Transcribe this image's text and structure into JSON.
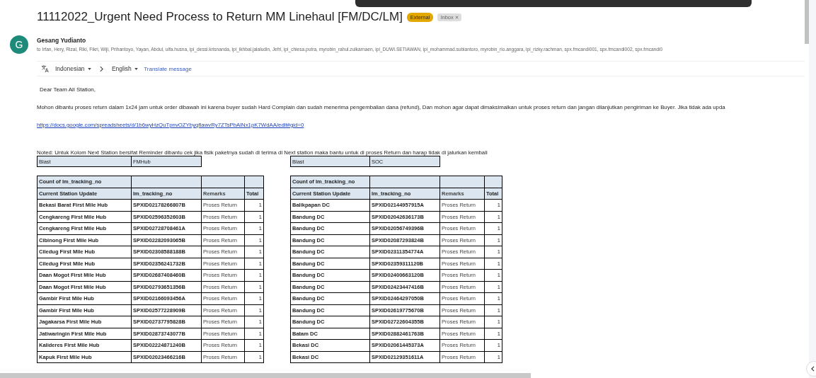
{
  "subject": "11112022_Urgent Need Process to Return MM Linehaul [FM/DC/LM]",
  "labels": [
    {
      "text": "External",
      "kind": "external"
    },
    {
      "text": "Inbox",
      "kind": "inbox"
    }
  ],
  "sender": {
    "initial": "G",
    "name": "Gesang Yudianto",
    "recipients": "to Irfan, Hery, Rizal, Riki, Fikri, Wiji, Prihantoyo, Yayan, Abdul, ulfa.husna, ipi_dessi.krisnanda, ipi_ikhbal.jalaludin, Jefri, ipi_chiesa.putra, myrobin_rahul.zulkarnaen, ipi_DUWI.SETIAWAN, ipi_mohammad.subiantoro, myrobin_rio.anggara, ipi_rizky.rachman, spx.fmcandi001, spx.fmcandi002, spx.fmcandi0"
  },
  "translate": {
    "from": "Indonesian",
    "to": "English",
    "action": "Translate message"
  },
  "body": {
    "greeting": "Dear Team All Station,",
    "paragraph": "Mohon dibantu proses return dalam 1x24 jam untuk order dibawah ini karena buyer sudah Hard Complain dan sudah menerima pengembalian dana (refund), Dan mohon agar dapat dimaksimalkan untuk proses return dan jangan dilanjutkan pengiriman ke Buyer. Jika tidak ada upda",
    "link": "https://docs.google.com/spreadsheets/d/1b6wyHzQuTpnvOZYbyqflawvRy7ZTsPbAlNx1pK7WdAA/edit#gid=0",
    "note": "Noted: Untuk Kolom Next Station bersifat Reminder dibantu cek jika fisik paketnya sudah di terima di Next station maka bantu untuk di proses Return dan harap tidak di jalurkan kembali"
  },
  "tables": [
    {
      "blast": [
        "Blast",
        "FMHub"
      ],
      "pivot_title": "Count of lm_tracking_no",
      "columns": [
        "Current Station Update",
        "lm_tracking_no",
        "Remarks",
        "Total"
      ],
      "rows": [
        [
          "Bekasi Barat First Mile Hub",
          "SPXID02178266807B",
          "Proses Return",
          "1"
        ],
        [
          "Cengkareng First Mile Hub",
          "SPXID02596352603B",
          "Proses Return",
          "1"
        ],
        [
          "Cengkareng First Mile Hub",
          "SPXID02728708461A",
          "Proses Return",
          "1"
        ],
        [
          "Cibinong First Mile Hub",
          "SPXID02282093065B",
          "Proses Return",
          "1"
        ],
        [
          "Ciledug First Mile Hub",
          "SPXID02308588188B",
          "Proses Return",
          "1"
        ],
        [
          "Ciledug First Mile Hub",
          "SPXID02356241732B",
          "Proses Return",
          "1"
        ],
        [
          "Daan Mogot First Mile Hub",
          "SPXID02687408460B",
          "Proses Return",
          "1"
        ],
        [
          "Daan Mogot First Mile Hub",
          "SPXID02793651356B",
          "Proses Return",
          "1"
        ],
        [
          "Gambir First Mile Hub",
          "SPXID02166093456A",
          "Proses Return",
          "1"
        ],
        [
          "Gambir First Mile Hub",
          "SPXID02577228909B",
          "Proses Return",
          "1"
        ],
        [
          "Jagakarsa First Mile Hub",
          "SPXID02737795828B",
          "Proses Return",
          "1"
        ],
        [
          "Jatiwaringin First Mile Hub",
          "SPXID02873743077B",
          "Proses Return",
          "1"
        ],
        [
          "Kalideres First Mile Hub",
          "SPXID02224871240B",
          "Proses Return",
          "1"
        ],
        [
          "Kapuk First Mile Hub",
          "SPXID02023466216B",
          "Proses Return",
          "1"
        ]
      ]
    },
    {
      "blast": [
        "Blast",
        "SOC"
      ],
      "pivot_title": "Count of lm_tracking_no",
      "columns": [
        "Current Station Update",
        "lm_tracking_no",
        "Remarks",
        "Total"
      ],
      "rows": [
        [
          "Balikpapan DC",
          "SPXID02144957915A",
          "Proses Return",
          "1"
        ],
        [
          "Bandung DC",
          "SPXID02042636173B",
          "Proses Return",
          "1"
        ],
        [
          "Bandung DC",
          "SPXID02056749396B",
          "Proses Return",
          "1"
        ],
        [
          "Bandung DC",
          "SPXID02087293824B",
          "Proses Return",
          "1"
        ],
        [
          "Bandung DC",
          "SPXID02311354774A",
          "Proses Return",
          "1"
        ],
        [
          "Bandung DC",
          "SPXID02359311120B",
          "Proses Return",
          "1"
        ],
        [
          "Bandung DC",
          "SPXID02400663120B",
          "Proses Return",
          "1"
        ],
        [
          "Bandung DC",
          "SPXID02423447416B",
          "Proses Return",
          "1"
        ],
        [
          "Bandung DC",
          "SPXID02464297050B",
          "Proses Return",
          "1"
        ],
        [
          "Bandung DC",
          "SPXID02619775670B",
          "Proses Return",
          "1"
        ],
        [
          "Bandung DC",
          "SPXID02722604355B",
          "Proses Return",
          "1"
        ],
        [
          "Batam DC",
          "SPXID02882461763B",
          "Proses Return",
          "1"
        ],
        [
          "Bekasi DC",
          "SPXID02061445373A",
          "Proses Return",
          "1"
        ],
        [
          "Bekasi DC",
          "SPXID02129351611A",
          "Proses Return",
          "1"
        ]
      ]
    }
  ]
}
